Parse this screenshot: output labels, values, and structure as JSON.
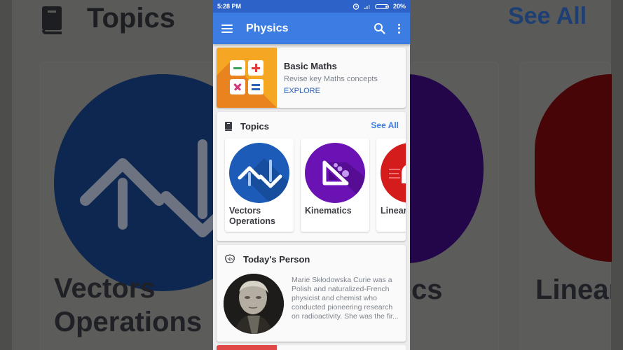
{
  "status_bar": {
    "time": "5:28 PM",
    "battery": "20%",
    "battery_level": 0.2,
    "icons": [
      "alarm-icon",
      "signal-icon",
      "battery-icon"
    ]
  },
  "app_bar": {
    "title": "Physics",
    "menu_icon": "hamburger-menu-icon",
    "search_icon": "search-icon",
    "more_icon": "more-vert-icon",
    "color": "#3b7de2"
  },
  "basic_maths": {
    "title": "Basic Maths",
    "subtitle": "Revise key Maths concepts",
    "action": "EXPLORE",
    "tiles": [
      "−",
      "+",
      "×",
      "="
    ],
    "tile_colors": [
      "#3aa35a",
      "#e23b3b",
      "#d1357a",
      "#2b63b5"
    ]
  },
  "topics": {
    "title": "Topics",
    "see_all": "See All",
    "items": [
      {
        "label_line1": "Vectors",
        "label_line2": "Operations",
        "icon": "vectors-icon",
        "color": "#1c5cb8"
      },
      {
        "label_line1": "Kinematics",
        "label_line2": "",
        "icon": "triangle-ruler-icon",
        "color": "#6b12b5"
      },
      {
        "label_line1": "Linear",
        "label_line2": "",
        "icon": "linear-motion-icon",
        "color": "#d41c1c"
      }
    ]
  },
  "todays_person": {
    "title": "Today's Person",
    "description": "Marie Skłodowska Curie was a Polish and naturalized-French physicist and chemist who conducted pioneering research on radioactivity. She was the fir..."
  },
  "background": {
    "title": "Topics",
    "see_all": "See All",
    "topic_line1": "Vectors",
    "topic_line2": "Operations",
    "topic2_fragment": "cs",
    "topic3": "Linear"
  }
}
